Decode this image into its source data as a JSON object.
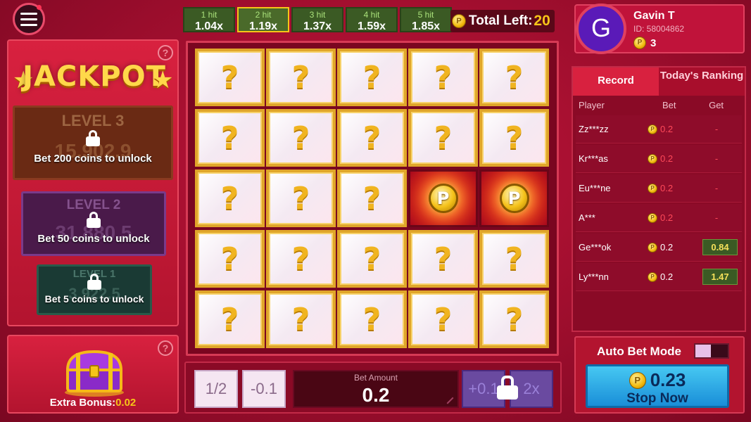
{
  "menu": {
    "icon": "hamburger-icon"
  },
  "multipliers": [
    {
      "hit": "1 hit",
      "value": "1.04x",
      "active": false
    },
    {
      "hit": "2 hit",
      "value": "1.19x",
      "active": true
    },
    {
      "hit": "3 hit",
      "value": "1.37x",
      "active": false
    },
    {
      "hit": "4 hit",
      "value": "1.59x",
      "active": false
    },
    {
      "hit": "5 hit",
      "value": "1.85x",
      "active": false
    }
  ],
  "total_left": {
    "label": "Total Left:",
    "value": "20"
  },
  "jackpot": {
    "title": "JACKPOT",
    "help": "?",
    "levels": [
      {
        "name": "LEVEL 3",
        "amount": "15,902.9",
        "unlock": "Bet 200 coins to unlock"
      },
      {
        "name": "LEVEL 2",
        "amount": "31,880.5",
        "unlock": "Bet 50 coins to unlock"
      },
      {
        "name": "LEVEL 1",
        "amount": "3,922.5",
        "unlock": "Bet 5 coins to unlock"
      }
    ]
  },
  "bonus": {
    "label": "Extra Bonus:",
    "value": "0.02",
    "help": "?"
  },
  "board": {
    "tiles": [
      "?",
      "?",
      "?",
      "?",
      "?",
      "?",
      "?",
      "?",
      "?",
      "?",
      "?",
      "?",
      "?",
      "P",
      "P",
      "?",
      "?",
      "?",
      "?",
      "?",
      "?",
      "?",
      "?",
      "?",
      "?"
    ]
  },
  "controls": {
    "half": "1/2",
    "minus": "-0.1",
    "bet_label": "Bet Amount",
    "bet_value": "0.2",
    "plus": "+0.1",
    "double": "2x"
  },
  "player": {
    "initial": "G",
    "name": "Gavin T",
    "id": "ID: 58004862",
    "balance": "3"
  },
  "record": {
    "tabs": [
      "Record",
      "Today's Ranking"
    ],
    "headers": [
      "Player",
      "Bet",
      "Get"
    ],
    "rows": [
      {
        "player": "Zz***zz",
        "bet": "0.2",
        "get": "-",
        "win": false
      },
      {
        "player": "Kr***as",
        "bet": "0.2",
        "get": "-",
        "win": false
      },
      {
        "player": "Eu***ne",
        "bet": "0.2",
        "get": "-",
        "win": false
      },
      {
        "player": "A***",
        "bet": "0.2",
        "get": "-",
        "win": false
      },
      {
        "player": "Ge***ok",
        "bet": "0.2",
        "get": "0.84",
        "win": true
      },
      {
        "player": "Ly***nn",
        "bet": "0.2",
        "get": "1.47",
        "win": true
      }
    ]
  },
  "autobet": {
    "label": "Auto Bet Mode",
    "amount": "0.23",
    "stop": "Stop Now"
  },
  "colors": {
    "accent": "#f5c518",
    "bg": "#c2153a",
    "win_green": "#3b5a24",
    "stop_blue": "#1a8ed8"
  }
}
